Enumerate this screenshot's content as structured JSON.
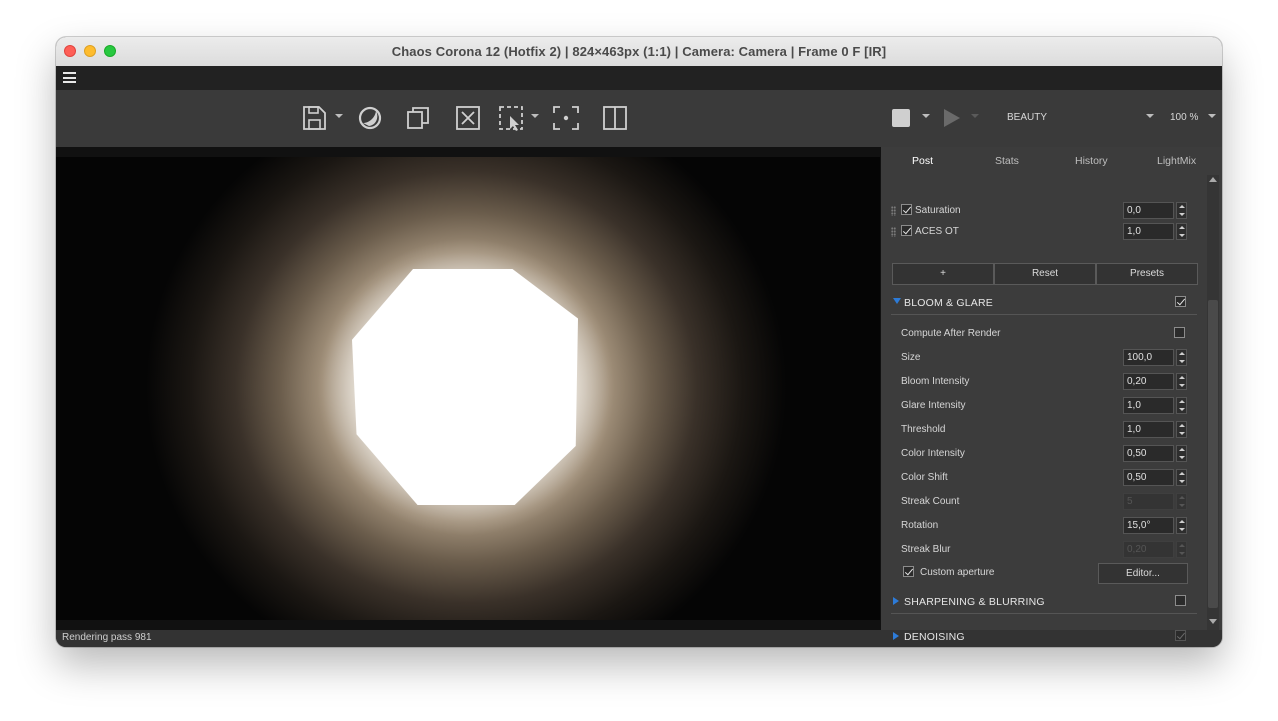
{
  "window": {
    "title": "Chaos Corona 12 (Hotfix 2) | 824×463px (1:1) | Camera: Camera | Frame 0 F [IR]"
  },
  "toolbar": {
    "icons": [
      "save-icon",
      "corona-logo-icon",
      "copy-icon",
      "clear-icon",
      "region-select-icon",
      "focus-point-icon",
      "split-view-icon",
      "stop-icon",
      "play-icon"
    ],
    "pass_label": "BEAUTY",
    "zoom": "100 %"
  },
  "tabs": [
    "Post",
    "Stats",
    "History",
    "LightMix"
  ],
  "active_tab": "Post",
  "tonemapping": {
    "items": [
      {
        "label": "Saturation",
        "value": "0,0",
        "checked": true
      },
      {
        "label": "ACES OT",
        "value": "1,0",
        "checked": true
      }
    ],
    "add_label": "+",
    "reset_label": "Reset",
    "presets_label": "Presets"
  },
  "bloom": {
    "title": "BLOOM & GLARE",
    "enabled": true,
    "compute_after_render": "Compute After Render",
    "rows": [
      {
        "label": "Size",
        "value": "100,0"
      },
      {
        "label": "Bloom Intensity",
        "value": "0,20"
      },
      {
        "label": "Glare Intensity",
        "value": "1,0"
      },
      {
        "label": "Threshold",
        "value": "1,0"
      },
      {
        "label": "Color Intensity",
        "value": "0,50"
      },
      {
        "label": "Color Shift",
        "value": "0,50"
      },
      {
        "label": "Streak Count",
        "value": "5",
        "disabled": true
      },
      {
        "label": "Rotation",
        "value": "15,0°"
      },
      {
        "label": "Streak Blur",
        "value": "0,20",
        "disabled": true
      }
    ],
    "custom_aperture": "Custom aperture",
    "custom_aperture_checked": true,
    "editor_label": "Editor..."
  },
  "sharpening": {
    "title": "SHARPENING & BLURRING",
    "enabled": false
  },
  "denoising": {
    "title": "DENOISING",
    "enabled": true
  },
  "status": {
    "text": "Rendering pass 981"
  },
  "colors": {
    "accent": "#2d7bd8",
    "panel": "#3c3c3c",
    "toolbar": "#3a3a3a"
  }
}
